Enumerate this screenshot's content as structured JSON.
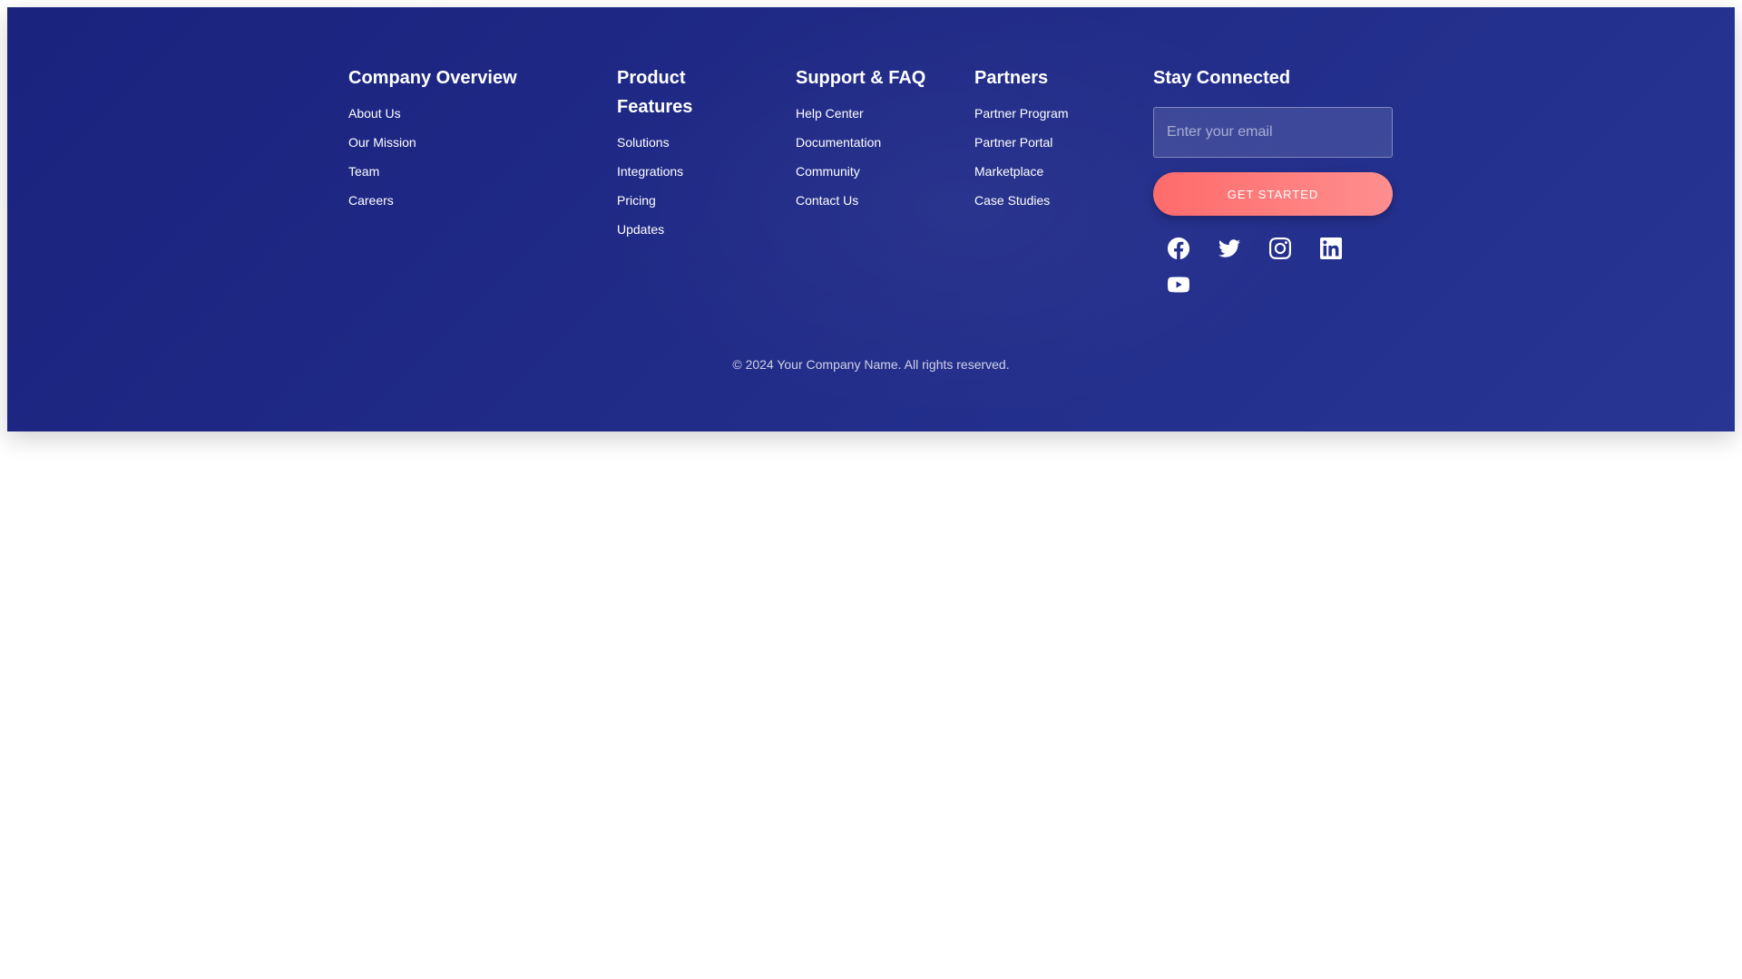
{
  "columns": [
    {
      "title": "Company Overview",
      "links": [
        "About Us",
        "Our Mission",
        "Team",
        "Careers"
      ]
    },
    {
      "title": "Product Features",
      "links": [
        "Solutions",
        "Integrations",
        "Pricing",
        "Updates"
      ]
    },
    {
      "title": "Support & FAQ",
      "links": [
        "Help Center",
        "Documentation",
        "Community",
        "Contact Us"
      ]
    },
    {
      "title": "Partners",
      "links": [
        "Partner Program",
        "Partner Portal",
        "Marketplace",
        "Case Studies"
      ]
    }
  ],
  "newsletter": {
    "title": "Stay Connected",
    "email_placeholder": "Enter your email",
    "button_label": "GET STARTED"
  },
  "social_icons": [
    "facebook-icon",
    "twitter-icon",
    "instagram-icon",
    "linkedin-icon",
    "youtube-icon"
  ],
  "copyright": "© 2024 Your Company Name. All rights reserved.",
  "colors": {
    "background_start": "#1a237e",
    "background_end": "#283593",
    "button_start": "#ff6b6b",
    "button_end": "#ff8e8e",
    "text": "#ffffff"
  }
}
